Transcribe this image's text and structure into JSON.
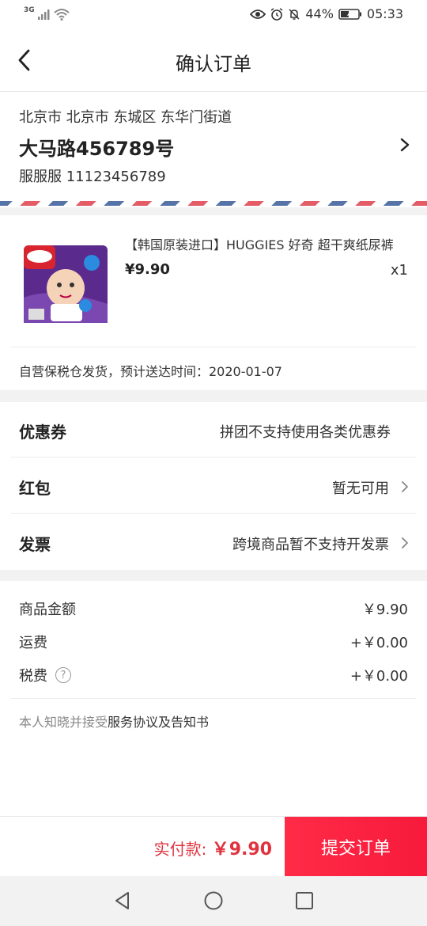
{
  "status_bar": {
    "network": "3G",
    "battery": "44%",
    "time": "05:33"
  },
  "header": {
    "title": "确认订单"
  },
  "address": {
    "region": "北京市 北京市 东城区 东华门街道",
    "street": "大马路456789号",
    "contact": "服服服 11123456789"
  },
  "product": {
    "name": "【韩国原装进口】HUGGIES 好奇 超干爽纸尿裤",
    "price": "¥9.90",
    "quantity": "x1",
    "delivery": "自营保税仓发货，预计送达时间：2020-01-07"
  },
  "options": {
    "coupon": {
      "label": "优惠券",
      "value": "拼团不支持使用各类优惠券"
    },
    "red_packet": {
      "label": "红包",
      "value": "暂无可用"
    },
    "invoice": {
      "label": "发票",
      "value": "跨境商品暂不支持开发票"
    }
  },
  "summary": {
    "goods_label": "商品金额",
    "goods_value": "￥9.90",
    "shipping_label": "运费",
    "shipping_value": "+￥0.00",
    "tax_label": "税费",
    "tax_value": "+￥0.00",
    "agreement_prefix": "本人知晓并接受",
    "agreement_link": "服务协议及告知书"
  },
  "footer": {
    "pay_label": "实付款:",
    "pay_amount": "￥9.90",
    "submit_label": "提交订单"
  },
  "colors": {
    "accent": "#f71a3b",
    "price_red": "#e0323f"
  },
  "icons": [
    "back-arrow-icon",
    "chevron-right-icon",
    "help-icon",
    "wifi-icon",
    "signal-icon",
    "eye-icon",
    "alarm-icon",
    "mute-icon",
    "battery-icon",
    "nav-back-icon",
    "nav-home-icon",
    "nav-recent-icon"
  ]
}
